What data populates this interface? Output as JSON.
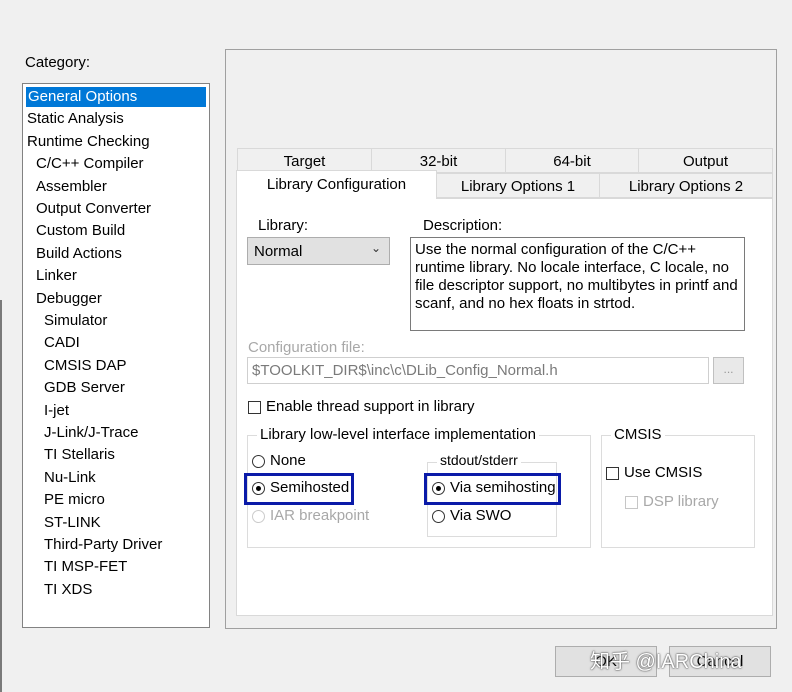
{
  "category": {
    "label": "Category:",
    "items": [
      {
        "label": "General Options",
        "level": 1,
        "selected": true
      },
      {
        "label": "Static Analysis",
        "level": 1
      },
      {
        "label": "Runtime Checking",
        "level": 1
      },
      {
        "label": "C/C++ Compiler",
        "level": 2
      },
      {
        "label": "Assembler",
        "level": 2
      },
      {
        "label": "Output Converter",
        "level": 2
      },
      {
        "label": "Custom Build",
        "level": 2
      },
      {
        "label": "Build Actions",
        "level": 2
      },
      {
        "label": "Linker",
        "level": 2
      },
      {
        "label": "Debugger",
        "level": 2
      },
      {
        "label": "Simulator",
        "level": 3
      },
      {
        "label": "CADI",
        "level": 3
      },
      {
        "label": "CMSIS DAP",
        "level": 3
      },
      {
        "label": "GDB Server",
        "level": 3
      },
      {
        "label": "I-jet",
        "level": 3
      },
      {
        "label": "J-Link/J-Trace",
        "level": 3
      },
      {
        "label": "TI Stellaris",
        "level": 3
      },
      {
        "label": "Nu-Link",
        "level": 3
      },
      {
        "label": "PE micro",
        "level": 3
      },
      {
        "label": "ST-LINK",
        "level": 3
      },
      {
        "label": "Third-Party Driver",
        "level": 3
      },
      {
        "label": "TI MSP-FET",
        "level": 3
      },
      {
        "label": "TI XDS",
        "level": 3
      }
    ]
  },
  "tabs": {
    "row1": [
      "Target",
      "32-bit",
      "64-bit",
      "Output"
    ],
    "row2": [
      "Library Configuration",
      "Library Options 1",
      "Library Options 2"
    ],
    "active": "Library Configuration"
  },
  "library": {
    "label": "Library:",
    "value": "Normal",
    "description_label": "Description:",
    "description": "Use the normal configuration of the C/C++ runtime library. No locale interface, C locale, no file descriptor support, no multibytes in printf and scanf, and no hex floats in strtod."
  },
  "config_file": {
    "label": "Configuration file:",
    "value": "$TOOLKIT_DIR$\\inc\\c\\DLib_Config_Normal.h",
    "browse": "..."
  },
  "thread_support": {
    "label": "Enable thread support in library",
    "checked": false
  },
  "lowlevel": {
    "title": "Library low-level interface implementation",
    "none": "None",
    "semihosted": "Semihosted",
    "iar_breakpoint": "IAR breakpoint",
    "selected": "Semihosted",
    "stdout": {
      "title": "stdout/stderr",
      "via_semihosting": "Via semihosting",
      "via_swo": "Via SWO",
      "selected": "Via semihosting"
    }
  },
  "cmsis": {
    "title": "CMSIS",
    "use_cmsis": "Use CMSIS",
    "dsp_library": "DSP library"
  },
  "buttons": {
    "ok": "OK",
    "cancel": "Cancel"
  },
  "watermark": "知乎 @IARChina",
  "colors": {
    "selection": "#0078d7",
    "highlight_box": "#0a1aa8"
  }
}
